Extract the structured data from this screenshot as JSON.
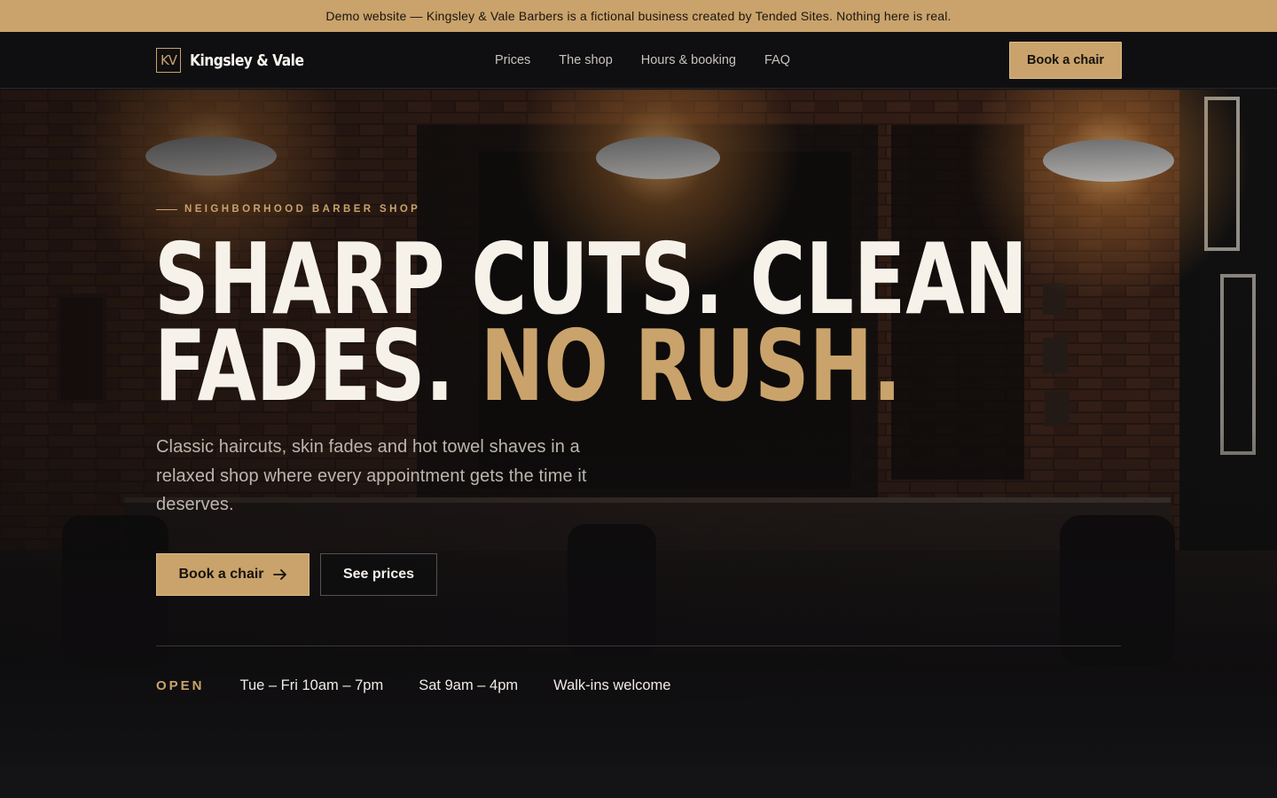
{
  "notice": {
    "text": "Demo website — Kingsley & Vale Barbers is a fictional business created by Tended Sites. Nothing here is real."
  },
  "brand": {
    "mark": "KV",
    "name": "Kingsley & Vale"
  },
  "nav": {
    "items": [
      {
        "label": "Prices"
      },
      {
        "label": "The shop"
      },
      {
        "label": "Hours & booking"
      },
      {
        "label": "FAQ"
      }
    ],
    "cta_label": "Book a chair"
  },
  "hero": {
    "eyebrow": "NEIGHBORHOOD BARBER SHOP",
    "headline_line1": "SHARP CUTS. CLEAN",
    "headline_line2_plain": "FADES.",
    "headline_line2_accent": "NO RUSH.",
    "lede": "Classic haircuts, skin fades and hot towel shaves in a relaxed shop where every appointment gets the time it deserves.",
    "primary_button": "Book a chair",
    "primary_button_icon": "arrow-right-icon",
    "secondary_button": "See prices"
  },
  "hours": {
    "label": "OPEN",
    "items": [
      "Tue – Fri 10am – 7pm",
      "Sat 9am – 4pm",
      "Walk-ins welcome"
    ]
  },
  "colors": {
    "accent": "#c9a36b",
    "header_bg": "#0f0f11",
    "text_light": "#f6f2ea",
    "text_muted": "#bdb6ac"
  }
}
